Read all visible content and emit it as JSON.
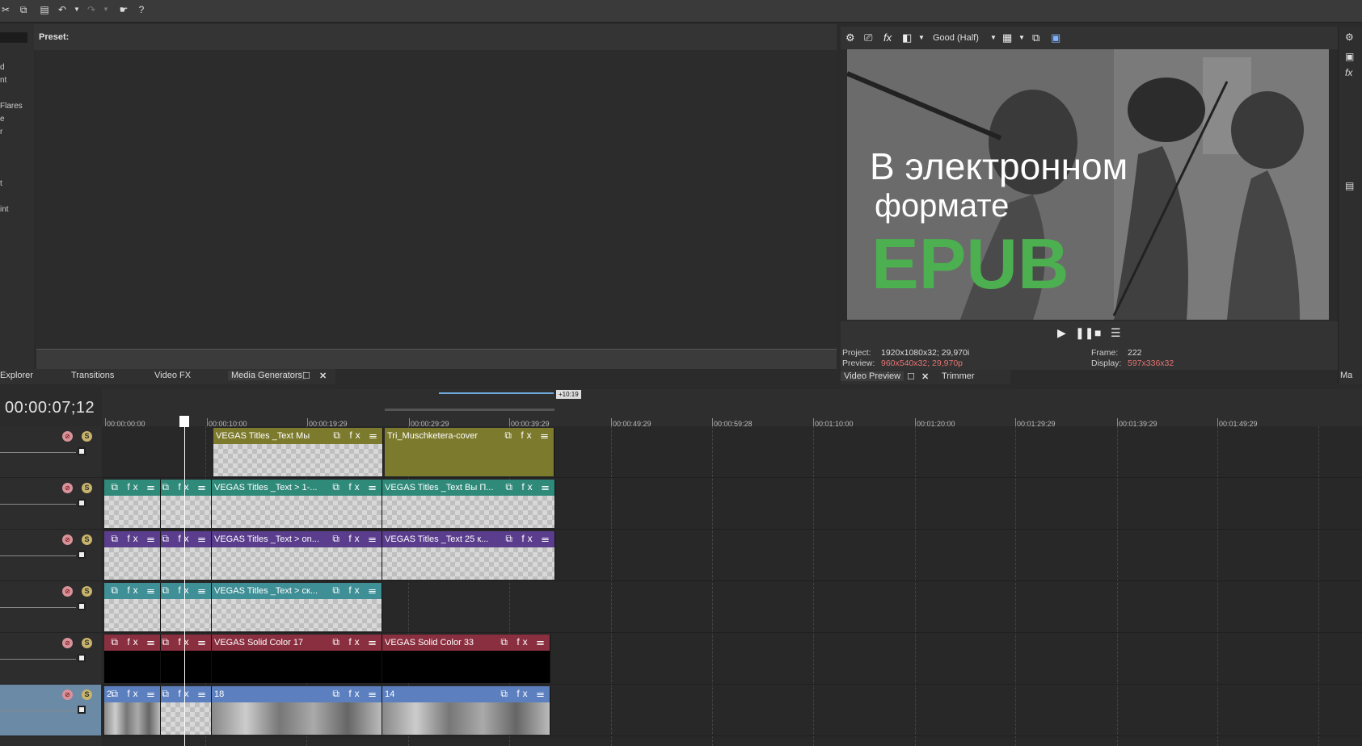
{
  "toolbar": {
    "icons": [
      "cut-icon",
      "copy-icon",
      "paste-icon",
      "undo-icon",
      "undo-dropdown-icon",
      "redo-icon",
      "redo-dropdown-icon",
      "whats-this-icon",
      "help-icon"
    ]
  },
  "left_list": {
    "items": [
      "d",
      "nt",
      "Flares",
      "e",
      "r",
      "t",
      "int"
    ]
  },
  "preset": {
    "label": "Preset:"
  },
  "left_tabs": {
    "tabs": [
      "Explorer",
      "Transitions",
      "Video FX",
      "Media Generators"
    ]
  },
  "preview": {
    "quality": "Good (Half)",
    "video_text": {
      "line1": "В электронном",
      "line2": "формате",
      "line3": "EPUB"
    },
    "info": {
      "project_label": "Project:",
      "project_value": "1920x1080x32; 29,970i",
      "preview_label": "Preview:",
      "preview_value": "960x540x32; 29,970p",
      "frame_label": "Frame:",
      "frame_value": "222",
      "display_label": "Display:",
      "display_value": "597x336x32"
    },
    "tabs": [
      "Video Preview",
      "Trimmer"
    ],
    "colors": {
      "accent_red": "#e57373",
      "epub_green": "#4caf50"
    }
  },
  "far_right": {
    "tab": "Ma"
  },
  "timeline": {
    "timecode": "00:00:07;12",
    "loop_label": "+10:19",
    "ruler_ticks": [
      "00:00:00;00",
      "00:00:10;00",
      "00:00:19;29",
      "00:00:29;29",
      "00:00:39;29",
      "00:00:49;29",
      "00:00:59;28",
      "00:01:10;00",
      "00:01:20;00",
      "00:01:29;29",
      "00:01:39;29",
      "00:01:49;29"
    ],
    "tracks": [
      {
        "events": [
          {
            "name": "VEGAS Titles _Text Мы",
            "color": "#7c7a2c"
          },
          {
            "name": "Tri_Muschketera-cover",
            "color": "#7c7a2c"
          }
        ]
      },
      {
        "events": [
          {
            "name": "",
            "color": "#2f8a7a"
          },
          {
            "name": "",
            "color": "#2f8a7a"
          },
          {
            "name": "VEGAS Titles _Text > 1-...",
            "color": "#2f8a7a"
          },
          {
            "name": "VEGAS Titles _Text Вы П...",
            "color": "#2f8a7a"
          }
        ]
      },
      {
        "events": [
          {
            "name": "",
            "color": "#5a3d8c"
          },
          {
            "name": "",
            "color": "#5a3d8c"
          },
          {
            "name": "VEGAS Titles _Text > on...",
            "color": "#5a3d8c"
          },
          {
            "name": "VEGAS Titles _Text 25 к...",
            "color": "#5a3d8c"
          }
        ]
      },
      {
        "events": [
          {
            "name": "",
            "color": "#3f8f96"
          },
          {
            "name": "",
            "color": "#3f8f96"
          },
          {
            "name": "VEGAS Titles _Text > ск...",
            "color": "#3f8f96"
          }
        ]
      },
      {
        "events": [
          {
            "name": "",
            "color": "#8a2f3f"
          },
          {
            "name": "",
            "color": "#8a2f3f"
          },
          {
            "name": "VEGAS Solid Color 17",
            "color": "#8a2f3f"
          },
          {
            "name": "VEGAS Solid Color 33",
            "color": "#8a2f3f"
          }
        ]
      },
      {
        "events": [
          {
            "name": "2.",
            "color": "#5b7fbf"
          },
          {
            "name": "",
            "color": "#5b7fbf"
          },
          {
            "name": "18",
            "color": "#5b7fbf"
          },
          {
            "name": "14",
            "color": "#5b7fbf"
          }
        ]
      }
    ]
  }
}
